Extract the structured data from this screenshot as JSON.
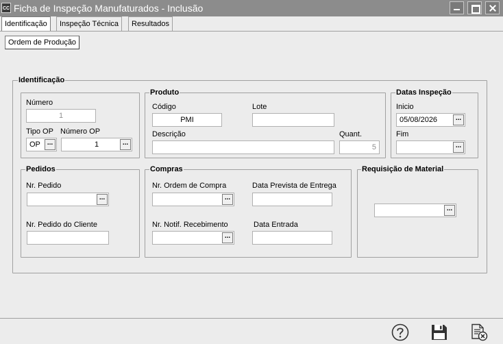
{
  "window": {
    "app_icon_text": "CC",
    "title": "Ficha de Inspeção Manufaturados - Inclusão"
  },
  "tabs": [
    "Identificação",
    "Inspeção Técnica",
    "Resultados"
  ],
  "subtabs": [
    "Ordem de Produção"
  ],
  "identificacao": {
    "legend": "Identificação",
    "numero": {
      "label": "Número",
      "value": "1"
    },
    "tipo_op": {
      "label": "Tipo OP",
      "value": "OP"
    },
    "numero_op": {
      "label": "Número OP",
      "value": "1"
    }
  },
  "produto": {
    "legend": "Produto",
    "codigo": {
      "label": "Código",
      "value": "PMI"
    },
    "lote": {
      "label": "Lote",
      "value": ""
    },
    "descricao": {
      "label": "Descrição",
      "value": ""
    },
    "quant": {
      "label": "Quant.",
      "value": "5"
    }
  },
  "datas": {
    "legend": "Datas Inspeção",
    "inicio": {
      "label": "Inicio",
      "value": "05/08/2026"
    },
    "fim": {
      "label": "Fim",
      "value": ""
    }
  },
  "pedidos": {
    "legend": "Pedidos",
    "nr_pedido": {
      "label": "Nr. Pedido",
      "value": ""
    },
    "nr_pedido_cliente": {
      "label": "Nr. Pedido do Cliente",
      "value": ""
    }
  },
  "compras": {
    "legend": "Compras",
    "nr_ordem_compra": {
      "label": "Nr. Ordem de Compra",
      "value": ""
    },
    "data_prevista": {
      "label": "Data Prevista de Entrega",
      "value": ""
    },
    "nr_notif": {
      "label": "Nr. Notif. Recebimento",
      "value": ""
    },
    "data_entrada": {
      "label": "Data Entrada",
      "value": ""
    }
  },
  "requisicao": {
    "legend": "Requisição de Material",
    "value": ""
  },
  "lookup_glyph": "...",
  "footer_icons": [
    "help-icon",
    "save-icon",
    "cancel-document-icon"
  ]
}
